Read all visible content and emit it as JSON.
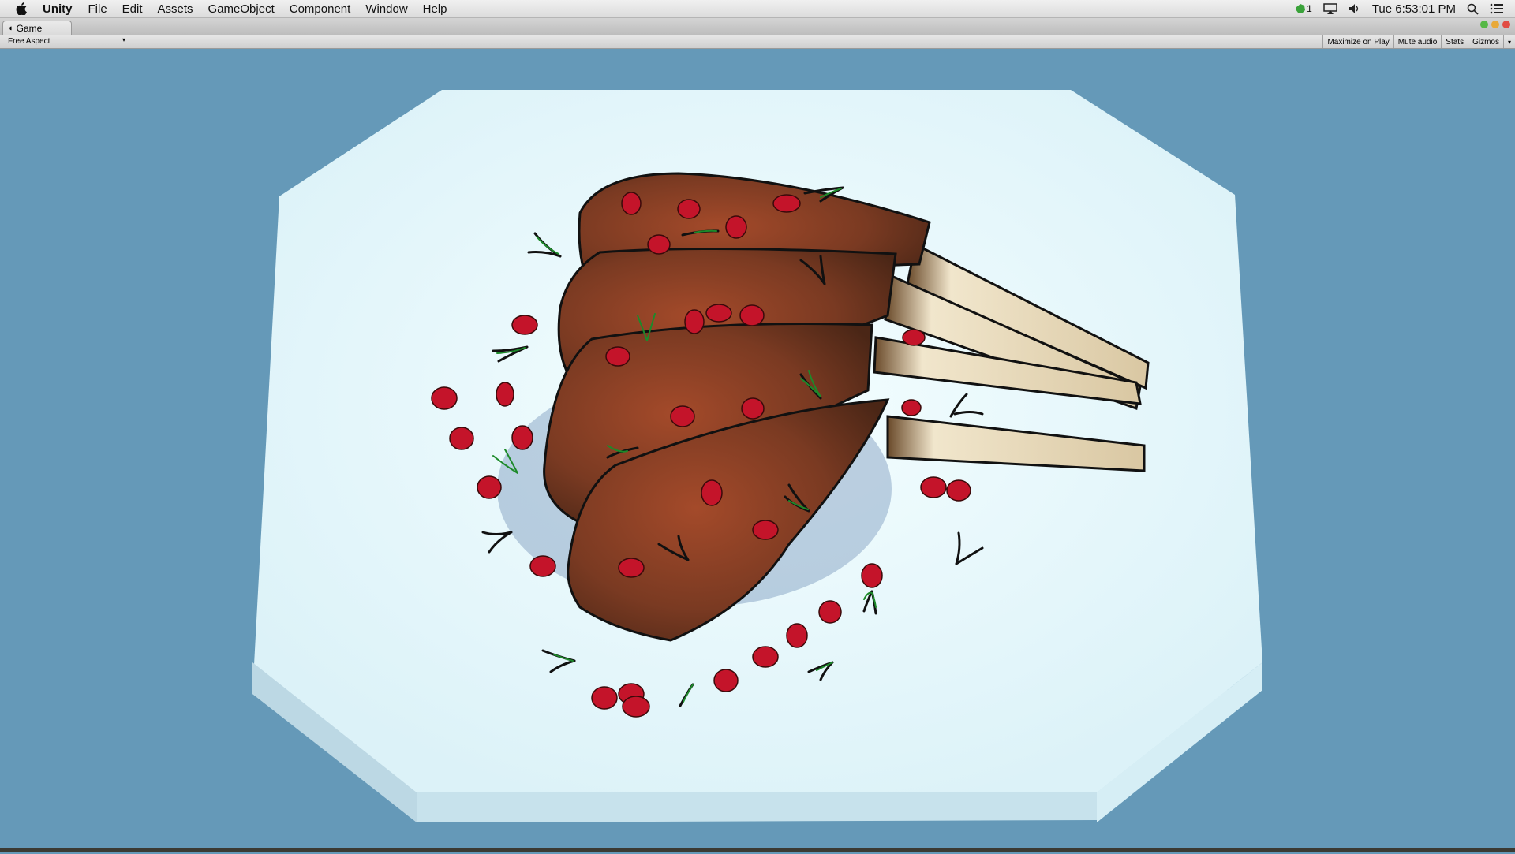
{
  "menubar": {
    "app": "Unity",
    "menus": [
      "File",
      "Edit",
      "Assets",
      "GameObject",
      "Component",
      "Window",
      "Help"
    ],
    "status_badge": "1",
    "clock": "Tue 6:53:01 PM"
  },
  "window": {
    "tab_title": "Game"
  },
  "toolbar": {
    "aspect": "Free Aspect",
    "buttons": [
      "Maximize on Play",
      "Mute audio",
      "Stats",
      "Gizmos"
    ]
  },
  "scene": {
    "description_icons": [
      "plate",
      "lamb-chop",
      "pomegranate-seed",
      "rosemary-sprig"
    ],
    "colors": {
      "background": "#6599b8",
      "plate": "#ecfbfd",
      "meat": "#7a3a22",
      "bone": "#e9dcc0",
      "seed": "#c4142a",
      "sprig": "#1d8a2a"
    }
  }
}
